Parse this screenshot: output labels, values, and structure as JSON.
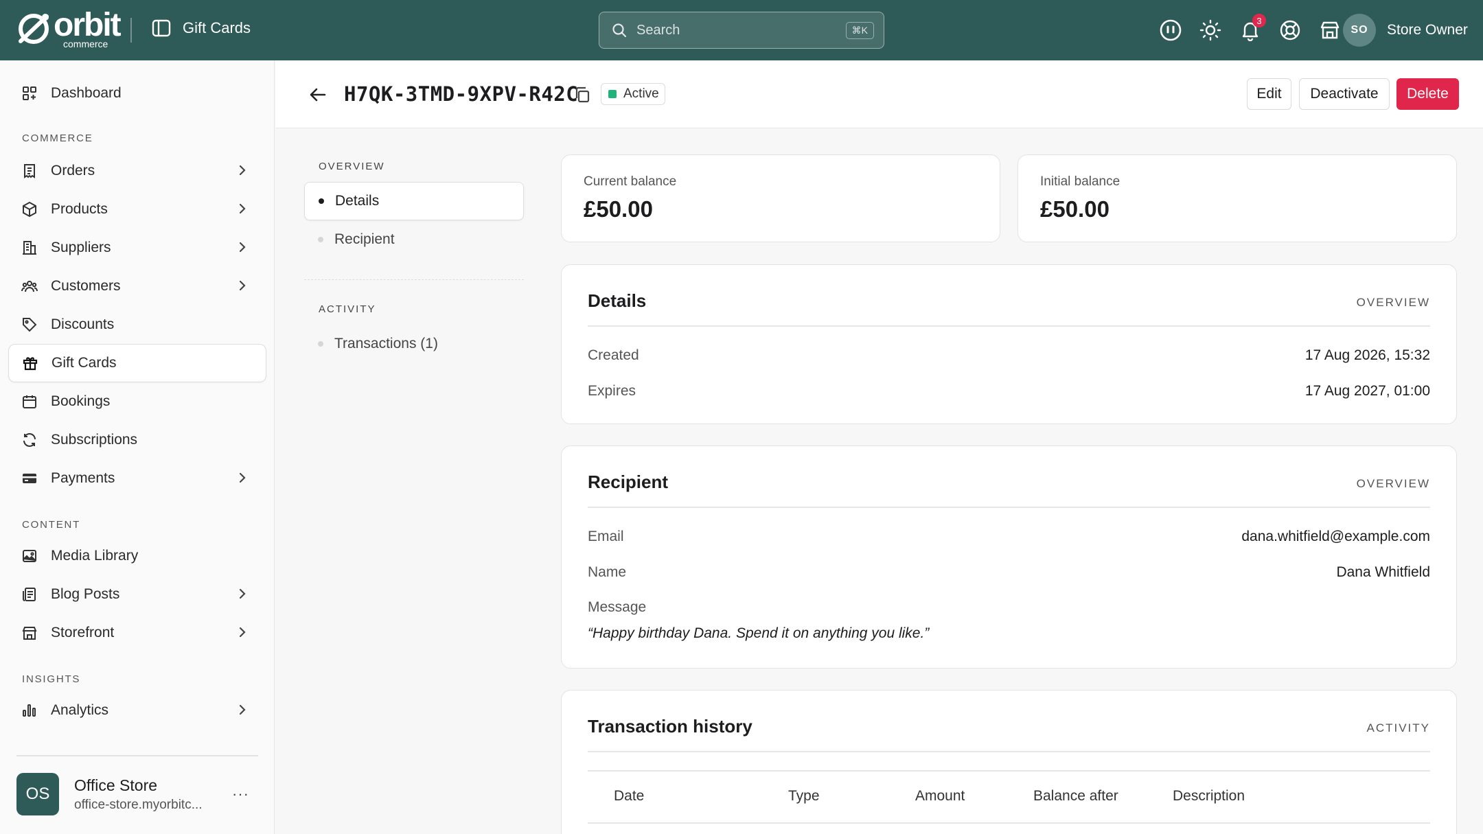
{
  "app": {
    "logo_word": "orbit",
    "logo_sub": "commerce",
    "page_title": "Gift Cards"
  },
  "search": {
    "placeholder": "Search",
    "shortcut": "⌘K"
  },
  "header_icons": {
    "notifications_count": "3"
  },
  "user": {
    "initials": "SO",
    "name": "Store Owner"
  },
  "sidebar": {
    "dashboard": "Dashboard",
    "sections": {
      "commerce": "COMMERCE",
      "content": "CONTENT",
      "insights": "INSIGHTS"
    },
    "items": {
      "orders": "Orders",
      "products": "Products",
      "suppliers": "Suppliers",
      "customers": "Customers",
      "discounts": "Discounts",
      "gift_cards": "Gift Cards",
      "bookings": "Bookings",
      "subscriptions": "Subscriptions",
      "payments": "Payments",
      "media_library": "Media Library",
      "blog_posts": "Blog Posts",
      "storefront": "Storefront",
      "analytics": "Analytics"
    },
    "store": {
      "initials": "OS",
      "name": "Office Store",
      "url": "office-store.myorbitc..."
    }
  },
  "detail": {
    "code": "H7QK-3TMD-9XPV-R42C",
    "status": "Active",
    "actions": {
      "edit": "Edit",
      "deactivate": "Deactivate",
      "delete": "Delete"
    }
  },
  "subnav": {
    "overview_label": "OVERVIEW",
    "activity_label": "ACTIVITY",
    "details": "Details",
    "recipient": "Recipient",
    "transactions": "Transactions (1)"
  },
  "balances": {
    "current_label": "Current balance",
    "current_value": "£50.00",
    "initial_label": "Initial balance",
    "initial_value": "£50.00"
  },
  "details_card": {
    "title": "Details",
    "tag": "OVERVIEW",
    "created_label": "Created",
    "created_value": "17 Aug 2026, 15:32",
    "expires_label": "Expires",
    "expires_value": "17 Aug 2027, 01:00"
  },
  "recipient_card": {
    "title": "Recipient",
    "tag": "OVERVIEW",
    "email_label": "Email",
    "email_value": "dana.whitfield@example.com",
    "name_label": "Name",
    "name_value": "Dana Whitfield",
    "message_label": "Message",
    "message_value": "“Happy birthday Dana. Spend it on anything you like.”"
  },
  "transactions_card": {
    "title": "Transaction history",
    "tag": "ACTIVITY",
    "columns": [
      "Date",
      "Type",
      "Amount",
      "Balance after",
      "Description"
    ]
  }
}
